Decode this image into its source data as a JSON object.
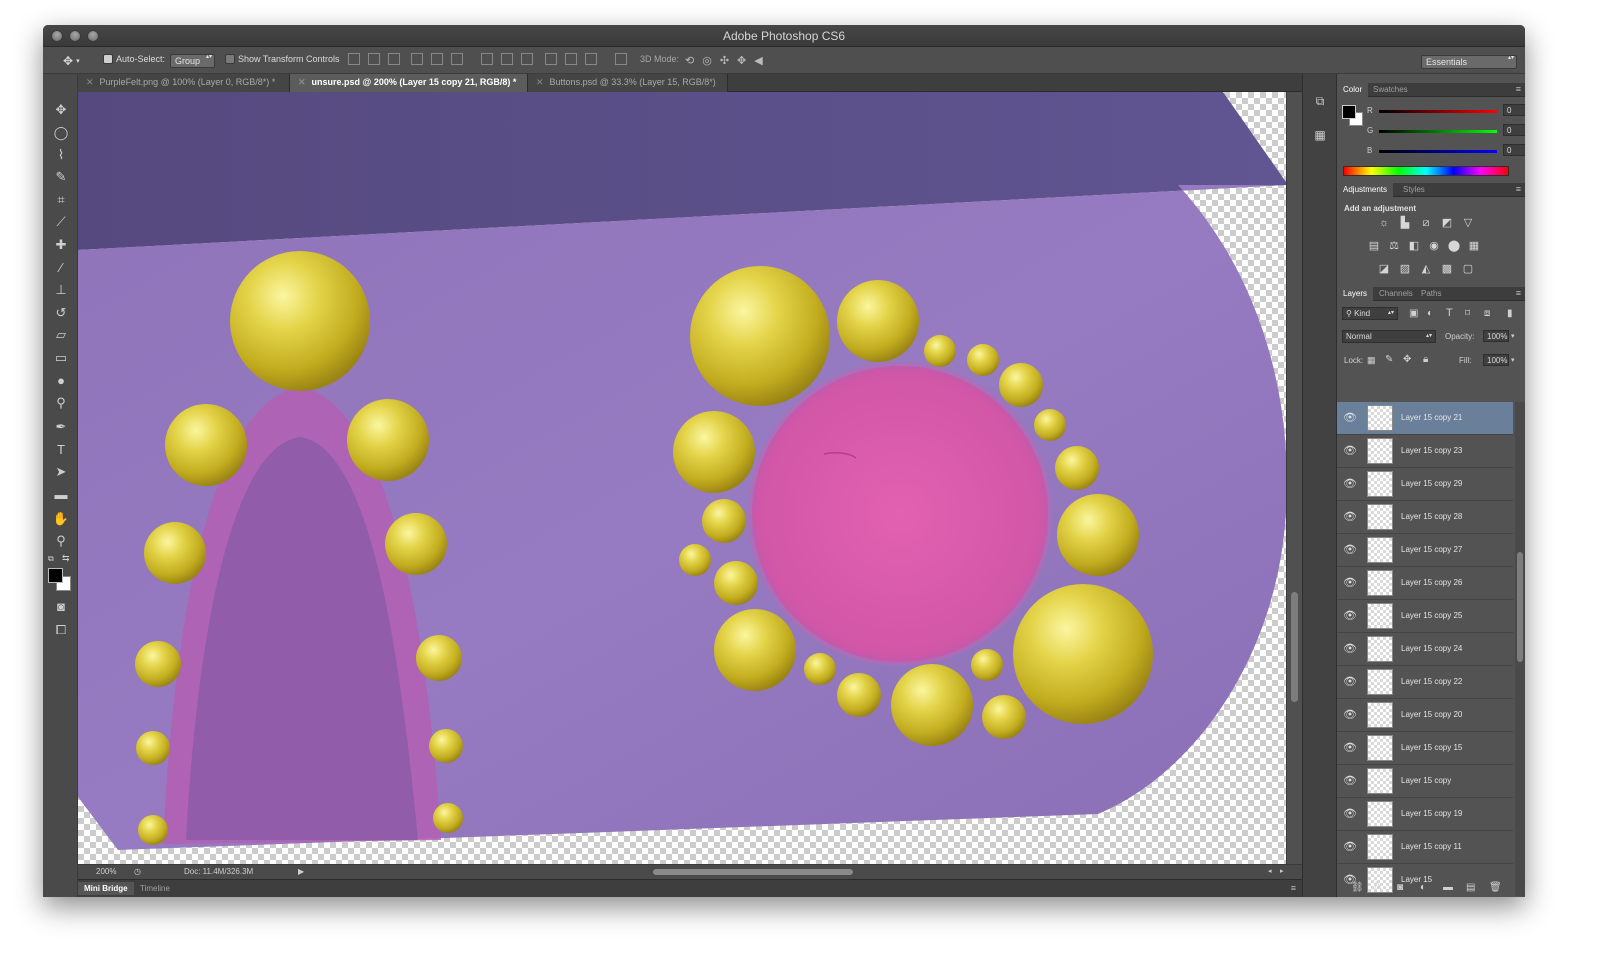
{
  "app": {
    "title": "Adobe Photoshop CS6"
  },
  "options_bar": {
    "auto_select_label": "Auto-Select:",
    "auto_select_value": "Group",
    "show_transform_label": "Show Transform Controls",
    "mode_3d_label": "3D Mode:",
    "workspace": "Essentials"
  },
  "doc_tabs": [
    {
      "label": "PurpleFelt.png @ 100% (Layer 0, RGB/8*) *"
    },
    {
      "label": "unsure.psd @ 200% (Layer 15 copy 21, RGB/8) *"
    },
    {
      "label": "Buttons.psd @ 33.3% (Layer 15, RGB/8*)"
    }
  ],
  "status": {
    "zoom": "200%",
    "doc": "Doc: 11.4M/326.3M"
  },
  "bottom_tabs": [
    {
      "label": "Mini Bridge"
    },
    {
      "label": "Timeline"
    }
  ],
  "color_panel": {
    "tabs": [
      {
        "label": "Color"
      },
      {
        "label": "Swatches"
      }
    ],
    "r_label": "R",
    "g_label": "G",
    "b_label": "B",
    "r_value": "0",
    "g_value": "0",
    "b_value": "0"
  },
  "adjustments_panel": {
    "tabs": [
      {
        "label": "Adjustments"
      },
      {
        "label": "Styles"
      }
    ],
    "heading": "Add an adjustment"
  },
  "layers_panel": {
    "tabs": [
      {
        "label": "Layers"
      },
      {
        "label": "Channels"
      },
      {
        "label": "Paths"
      }
    ],
    "kind_label": "Kind",
    "blend_mode": "Normal",
    "opacity_label": "Opacity:",
    "opacity_value": "100%",
    "lock_label": "Lock:",
    "fill_label": "Fill:",
    "fill_value": "100%",
    "layers": [
      {
        "name": "Layer 15 copy 21",
        "selected": true
      },
      {
        "name": "Layer 15 copy 23"
      },
      {
        "name": "Layer 15 copy 29"
      },
      {
        "name": "Layer 15 copy 28"
      },
      {
        "name": "Layer 15 copy 27"
      },
      {
        "name": "Layer 15 copy 26"
      },
      {
        "name": "Layer 15 copy 25"
      },
      {
        "name": "Layer 15 copy 24"
      },
      {
        "name": "Layer 15 copy 22"
      },
      {
        "name": "Layer 15 copy 20"
      },
      {
        "name": "Layer 15 copy 15"
      },
      {
        "name": "Layer 15 copy"
      },
      {
        "name": "Layer 15 copy 19"
      },
      {
        "name": "Layer 15 copy 11"
      },
      {
        "name": "Layer 15"
      }
    ]
  },
  "colors": {
    "window_bg": "#535353",
    "selection": "#6a7f9a",
    "felt_purple": "#8e72b8",
    "felt_dark": "#5a4f8c",
    "pink": "#d85aa8",
    "gold": "#d9c93a"
  }
}
